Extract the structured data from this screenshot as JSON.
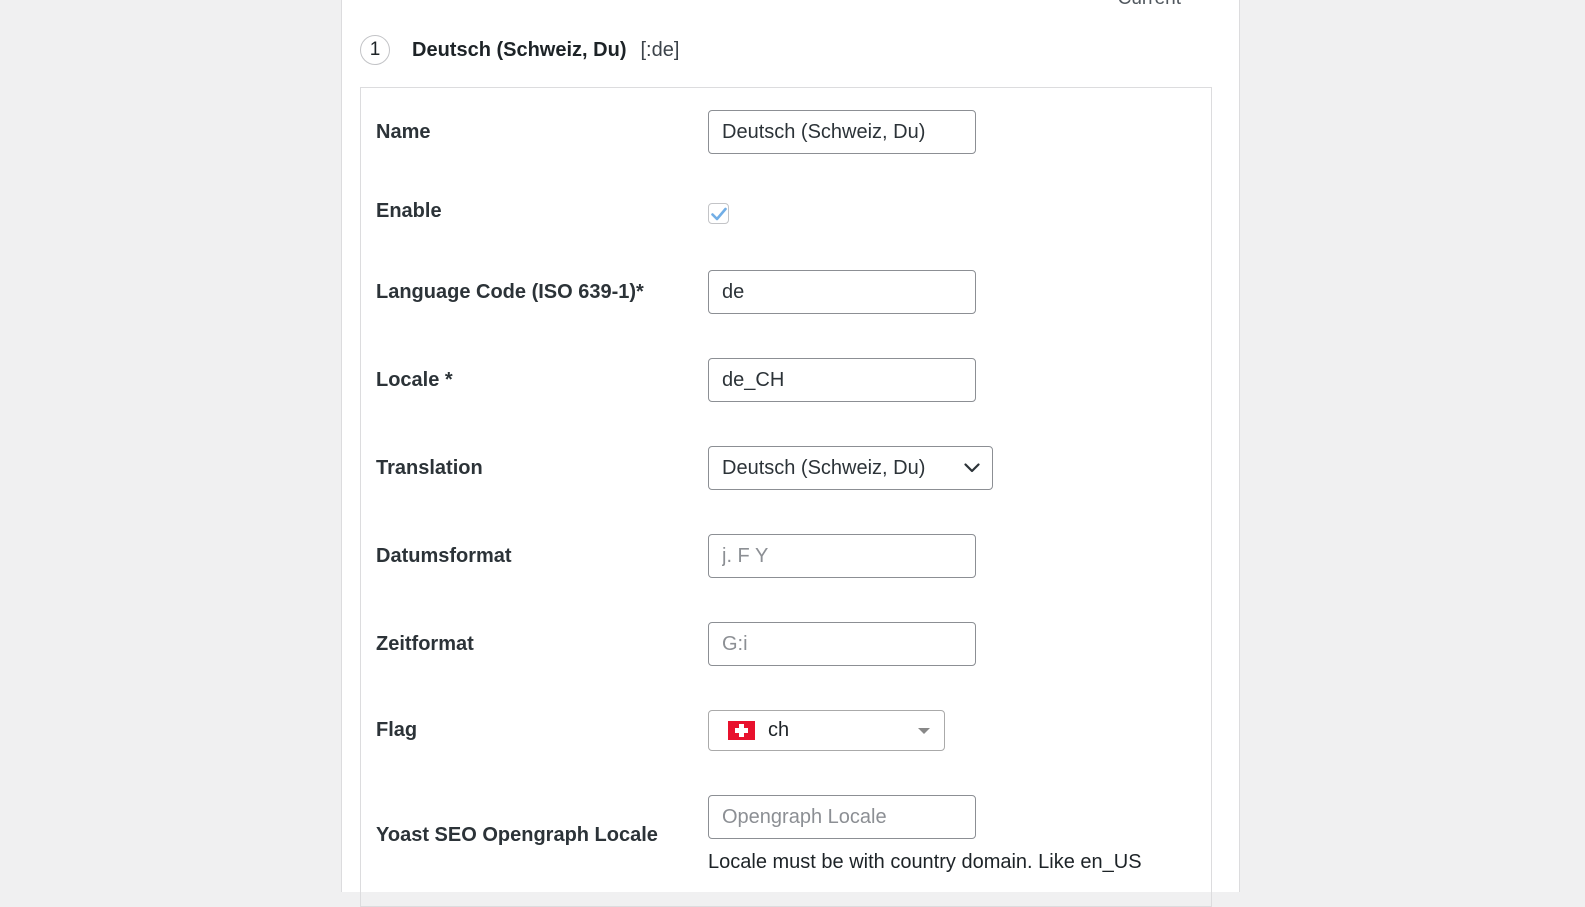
{
  "header": {
    "current_label": "Current"
  },
  "language": {
    "number": "1",
    "title": "Deutsch (Schweiz, Du)",
    "code": "[:de]"
  },
  "form": {
    "name": {
      "label": "Name",
      "value": "Deutsch (Schweiz, Du)"
    },
    "enable": {
      "label": "Enable",
      "checked": true,
      "check_icon": "check-icon"
    },
    "language_code": {
      "label": "Language Code (ISO 639-1)*",
      "value": "de"
    },
    "locale": {
      "label": "Locale *",
      "value": "de_CH"
    },
    "translation": {
      "label": "Translation",
      "selected": "Deutsch (Schweiz, Du)",
      "icon": "chevron-down-icon"
    },
    "date_format": {
      "label": "Datumsformat",
      "value": "",
      "placeholder": "j. F Y"
    },
    "time_format": {
      "label": "Zeitformat",
      "value": "",
      "placeholder": "G:i"
    },
    "flag": {
      "label": "Flag",
      "selected": "ch",
      "icon": "swiss-flag-icon"
    },
    "og_locale": {
      "label": "Yoast SEO Opengraph Locale",
      "value": "",
      "placeholder": "Opengraph Locale",
      "help": "Locale must be with country domain. Like en_US"
    }
  },
  "colors": {
    "check": "#72aee6",
    "flag_red": "#e8112d",
    "border": "#8c8f94"
  }
}
